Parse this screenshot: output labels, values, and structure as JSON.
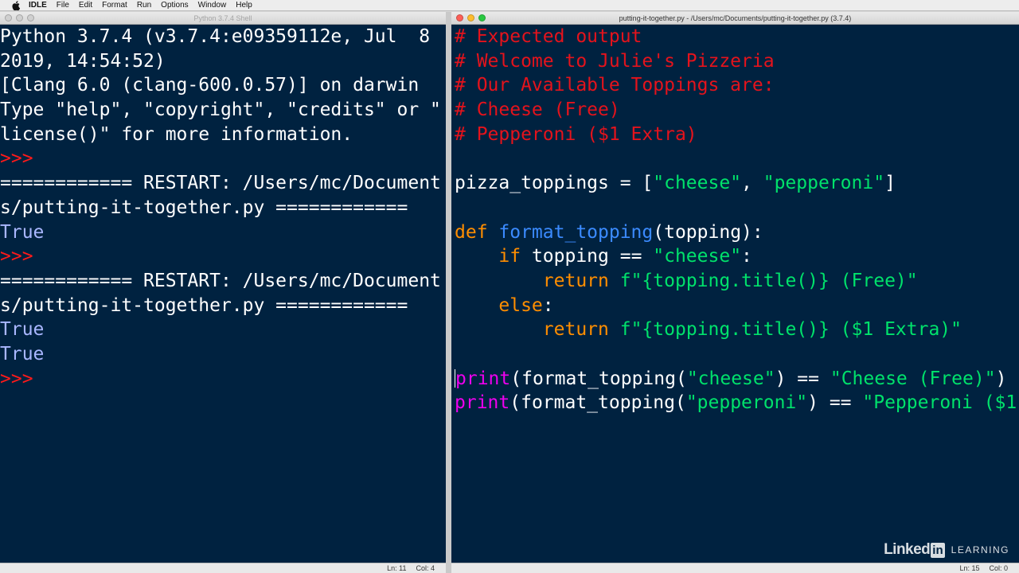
{
  "menubar": {
    "app": "IDLE",
    "items": [
      "File",
      "Edit",
      "Format",
      "Run",
      "Options",
      "Window",
      "Help"
    ]
  },
  "shell": {
    "title": "Python 3.7.4 Shell",
    "lines": [
      [
        {
          "t": "Python 3.7.4 (v3.7.4:e09359112e, Jul  8",
          "c": "white"
        }
      ],
      [
        {
          "t": "2019, 14:54:52)",
          "c": "white"
        }
      ],
      [
        {
          "t": "[Clang 6.0 (clang-600.0.57)] on darwin",
          "c": "white"
        }
      ],
      [
        {
          "t": "Type \"help\", \"copyright\", \"credits\" or \"",
          "c": "white"
        }
      ],
      [
        {
          "t": "license()\" for more information.",
          "c": "white"
        }
      ],
      [
        {
          "t": ">>> ",
          "c": "prompt"
        }
      ],
      [
        {
          "t": "============ RESTART: /Users/mc/Document",
          "c": "white"
        }
      ],
      [
        {
          "t": "s/putting-it-together.py ============",
          "c": "white"
        }
      ],
      [
        {
          "t": "True",
          "c": "output"
        }
      ],
      [
        {
          "t": ">>> ",
          "c": "prompt"
        }
      ],
      [
        {
          "t": "============ RESTART: /Users/mc/Document",
          "c": "white"
        }
      ],
      [
        {
          "t": "s/putting-it-together.py ============",
          "c": "white"
        }
      ],
      [
        {
          "t": "True",
          "c": "output"
        }
      ],
      [
        {
          "t": "True",
          "c": "output"
        }
      ],
      [
        {
          "t": ">>> ",
          "c": "prompt"
        }
      ]
    ],
    "status": {
      "ln": "Ln: 11",
      "col": "Col: 4"
    }
  },
  "editor": {
    "title": "putting-it-together.py - /Users/mc/Documents/putting-it-together.py (3.7.4)",
    "lines": [
      [
        {
          "t": "# Expected output",
          "c": "comment"
        }
      ],
      [
        {
          "t": "# Welcome to Julie's Pizzeria",
          "c": "comment"
        }
      ],
      [
        {
          "t": "# Our Available Toppings are:",
          "c": "comment"
        }
      ],
      [
        {
          "t": "# Cheese (Free)",
          "c": "comment"
        }
      ],
      [
        {
          "t": "# Pepperoni ($1 Extra)",
          "c": "comment"
        }
      ],
      [],
      [
        {
          "t": "pizza_toppings = [",
          "c": "plain"
        },
        {
          "t": "\"cheese\"",
          "c": "string"
        },
        {
          "t": ", ",
          "c": "plain"
        },
        {
          "t": "\"pepperoni\"",
          "c": "string"
        },
        {
          "t": "]",
          "c": "plain"
        }
      ],
      [],
      [
        {
          "t": "def ",
          "c": "keyword"
        },
        {
          "t": "format_topping",
          "c": "defname"
        },
        {
          "t": "(topping):",
          "c": "plain"
        }
      ],
      [
        {
          "t": "    ",
          "c": "plain"
        },
        {
          "t": "if",
          "c": "keyword"
        },
        {
          "t": " topping == ",
          "c": "plain"
        },
        {
          "t": "\"cheese\"",
          "c": "string"
        },
        {
          "t": ":",
          "c": "plain"
        }
      ],
      [
        {
          "t": "        ",
          "c": "plain"
        },
        {
          "t": "return",
          "c": "keyword"
        },
        {
          "t": " ",
          "c": "plain"
        },
        {
          "t": "f\"{topping.title()} (Free)\"",
          "c": "string"
        }
      ],
      [
        {
          "t": "    ",
          "c": "plain"
        },
        {
          "t": "else",
          "c": "keyword"
        },
        {
          "t": ":",
          "c": "plain"
        }
      ],
      [
        {
          "t": "        ",
          "c": "plain"
        },
        {
          "t": "return",
          "c": "keyword"
        },
        {
          "t": " ",
          "c": "plain"
        },
        {
          "t": "f\"{topping.title()} ($1 Extra)\"",
          "c": "string"
        }
      ],
      [],
      [
        {
          "t": "print",
          "c": "builtin"
        },
        {
          "t": "(format_topping(",
          "c": "plain"
        },
        {
          "t": "\"cheese\"",
          "c": "string"
        },
        {
          "t": ") == ",
          "c": "plain"
        },
        {
          "t": "\"Cheese (Free)\"",
          "c": "string"
        },
        {
          "t": ")",
          "c": "plain"
        }
      ],
      [
        {
          "t": "print",
          "c": "builtin"
        },
        {
          "t": "(format_topping(",
          "c": "plain"
        },
        {
          "t": "\"pepperoni\"",
          "c": "string"
        },
        {
          "t": ") == ",
          "c": "plain"
        },
        {
          "t": "\"Pepperoni ($1",
          "c": "string"
        }
      ]
    ],
    "status": {
      "ln": "Ln: 15",
      "col": "Col: 0"
    }
  },
  "watermark": {
    "brand": "Linked",
    "in": "in",
    "suffix": "LEARNING"
  },
  "colors": {
    "background": "#002240",
    "prompt": "#ff1a1a",
    "comment": "#e4131c",
    "keyword": "#ff8e00",
    "builtin": "#ee00ee",
    "string": "#00e26b",
    "defname": "#3b8bff",
    "output": "#a9b7ff"
  }
}
